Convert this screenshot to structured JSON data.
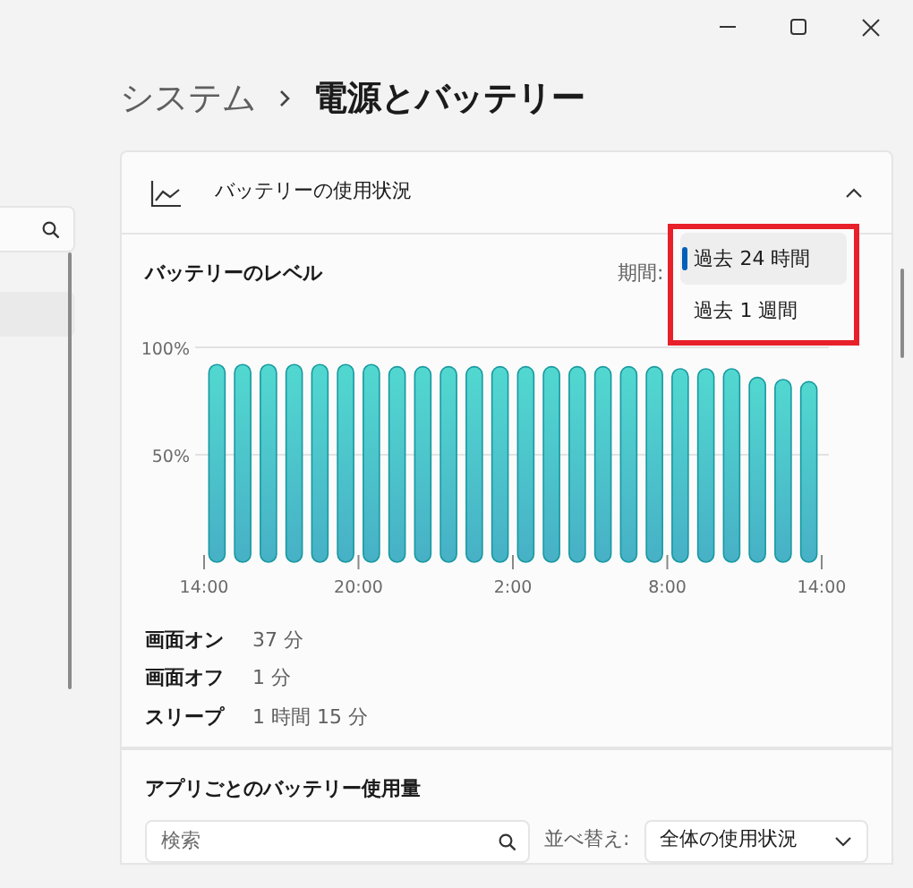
{
  "breadcrumb": [
    {
      "label": "システム",
      "current": false
    },
    {
      "label": "電源とバッテリー",
      "current": true
    }
  ],
  "usage_section": {
    "title": "バッテリーの使用状況",
    "expanded": true,
    "level_title": "バッテリーのレベル",
    "period_label": "期間:",
    "period_options": [
      {
        "label": "過去 24 時間",
        "selected": true
      },
      {
        "label": "過去 1 週間",
        "selected": false
      }
    ],
    "chart_data": {
      "type": "bar",
      "categories": [
        "14:00",
        null,
        null,
        null,
        null,
        null,
        "20:00",
        null,
        null,
        null,
        null,
        null,
        "2:00",
        null,
        null,
        null,
        null,
        null,
        "8:00",
        null,
        null,
        null,
        null,
        null,
        "14:00"
      ],
      "values": [
        92,
        92,
        92,
        92,
        92,
        92,
        92,
        91,
        91,
        91,
        91,
        91,
        91,
        91,
        91,
        91,
        91,
        91,
        90,
        90,
        90,
        86,
        85,
        84,
        null
      ],
      "ylim": [
        0,
        100
      ],
      "yticks": [
        {
          "value": 50,
          "label": "50%"
        },
        {
          "value": 100,
          "label": "100%"
        }
      ]
    },
    "stats": [
      {
        "label": "画面オン",
        "value": "37 分"
      },
      {
        "label": "画面オフ",
        "value": "1 分"
      },
      {
        "label": "スリープ",
        "value": "1 時間 15 分"
      }
    ]
  },
  "app_usage": {
    "title": "アプリごとのバッテリー使用量",
    "search": {
      "placeholder": "検索"
    },
    "sort_label": "並べ替え:",
    "sort_value": "全体の使用状況"
  }
}
